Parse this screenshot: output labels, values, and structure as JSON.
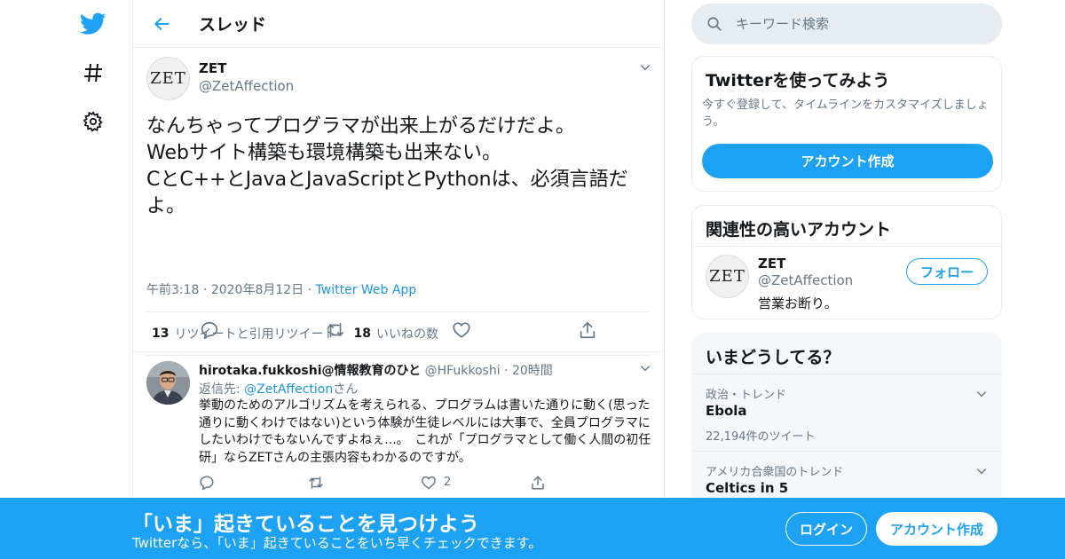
{
  "colors": {
    "accent": "#1da1f2",
    "link": "#1b95e0",
    "muted": "#657786",
    "text": "#14171a"
  },
  "nav": {
    "icons": [
      "twitter-bird-icon",
      "hashtag-icon",
      "gear-icon"
    ]
  },
  "header": {
    "title": "スレッド"
  },
  "tweet": {
    "avatar_text": "ZET",
    "name": "ZET",
    "handle": "@ZetAffection",
    "text": "なんちゃってプログラマが出来上がるだけだよ。\nWebサイト構築も環境構築も出来ない。\nCとC++とJavaとJavaScriptとPythonは、必須言語だよ。",
    "time": "午前3:18",
    "date": "2020年8月12日",
    "app": "Twitter Web App",
    "retweet_count": "13",
    "retweet_label": "リツイートと引用リツイート",
    "like_count": "18",
    "like_label": "いいねの数"
  },
  "reply": {
    "name": "hirotaka.fukkoshi@情報教育のひと",
    "handle": "@HFukkoshi",
    "time": "20時間",
    "reply_to_prefix": "返信先: ",
    "reply_to_mention": "@ZetAffection",
    "reply_to_suffix": "さん",
    "text": "挙動のためのアルゴリズムを考えられる、プログラムは書いた通りに動く(思った通りに動くわけではない)という体験が生徒レベルには大事で、全員プログラマにしたいわけでもないんですよねぇ...。　これが「プログラマとして働く人間の初任研」ならZETさんの主張内容もわかるのですが。",
    "like_count": "2"
  },
  "search": {
    "placeholder": "キーワード検索"
  },
  "signup_card": {
    "title": "Twitterを使ってみよう",
    "description": "今すぐ登録して、タイムラインをカスタマイズしましょう。",
    "button": "アカウント作成"
  },
  "related_card": {
    "title": "関連性の高いアカウント",
    "avatar_text": "ZET",
    "name": "ZET",
    "handle": "@ZetAffection",
    "bio": "営業お断り。",
    "follow_button": "フォロー"
  },
  "trends_card": {
    "title": "いまどうしてる？",
    "items": [
      {
        "context": "政治・トレンド",
        "name": "Ebola",
        "count": "22,194件のツイート"
      },
      {
        "context": "アメリカ合衆国のトレンド",
        "name": "Celtics in 5",
        "count": ""
      }
    ]
  },
  "bottom_bar": {
    "title": "「いま」起きていることを見つけよう",
    "subtitle": "Twitterなら、「いま」起きていることをいち早くチェックできます。",
    "login": "ログイン",
    "signup": "アカウント作成"
  }
}
